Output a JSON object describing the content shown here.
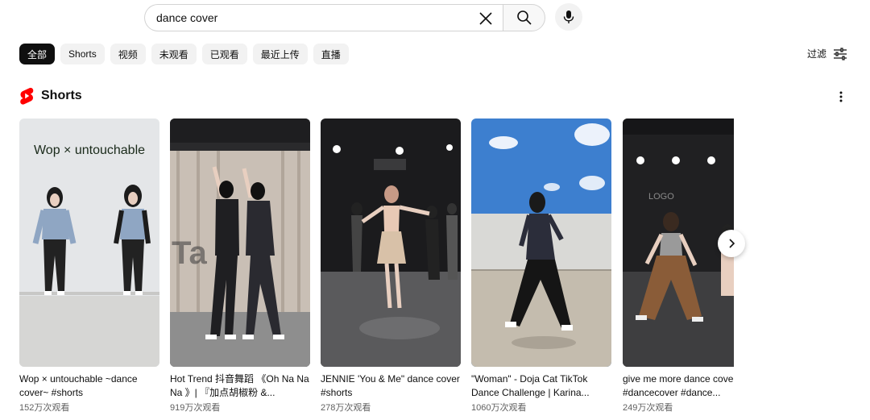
{
  "search": {
    "query": "dance cover"
  },
  "chips": [
    "全部",
    "Shorts",
    "视频",
    "未观看",
    "已观看",
    "最近上传",
    "直播"
  ],
  "filter_label": "过滤",
  "section": {
    "title": "Shorts",
    "brand_color": "#ff0000"
  },
  "cards": [
    {
      "title": "Wop × untouchable ~dance cover~ #shorts",
      "views": "152万次观看",
      "overlay": "Wop × untouchable"
    },
    {
      "title": "Hot Trend 抖音舞蹈 《Oh Na Na Na 》| 『加点胡椒粉 &...",
      "views": "919万次观看"
    },
    {
      "title": "JENNIE 'You & Me\" dance cover #shorts",
      "views": "278万次观看"
    },
    {
      "title": "\"Woman\" - Doja Cat TikTok Dance Challenge | Karina...",
      "views": "1060万次观看"
    },
    {
      "title": "give me more dance cover #dancecover #dance...",
      "views": "249万次观看"
    }
  ]
}
